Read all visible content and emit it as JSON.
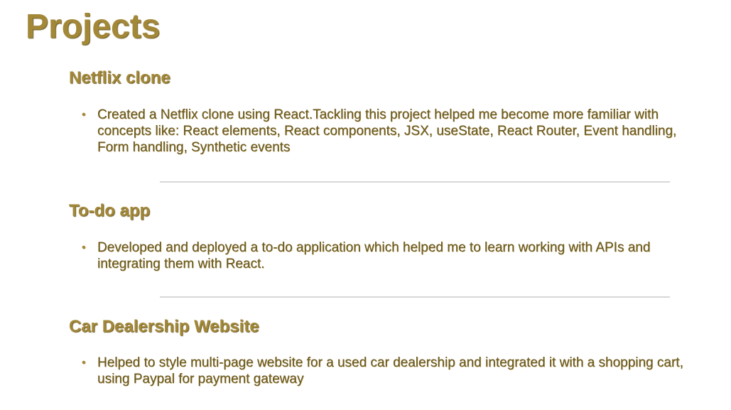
{
  "page": {
    "title": "Projects"
  },
  "projects": [
    {
      "title": "Netflix clone",
      "items": [
        "Created a Netflix clone using React.Tackling this project helped me become more familiar with concepts like: React elements, React components, JSX, useState, React Router, Event handling, Form handling, Synthetic events"
      ]
    },
    {
      "title": "To-do app",
      "items": [
        "Developed and deployed a to-do application which helped me to learn working with APIs and integrating them with React."
      ]
    },
    {
      "title": "Car Dealership Website",
      "items": [
        "Helped to style multi-page website for a used car dealership and integrated it with a shopping cart, using Paypal for payment gateway"
      ]
    }
  ],
  "colors": {
    "heading": "#a38838",
    "text": "#6b5a23",
    "divider": "#d8d8d8"
  },
  "icons": {
    "bullet": "bullet-dot-icon"
  }
}
